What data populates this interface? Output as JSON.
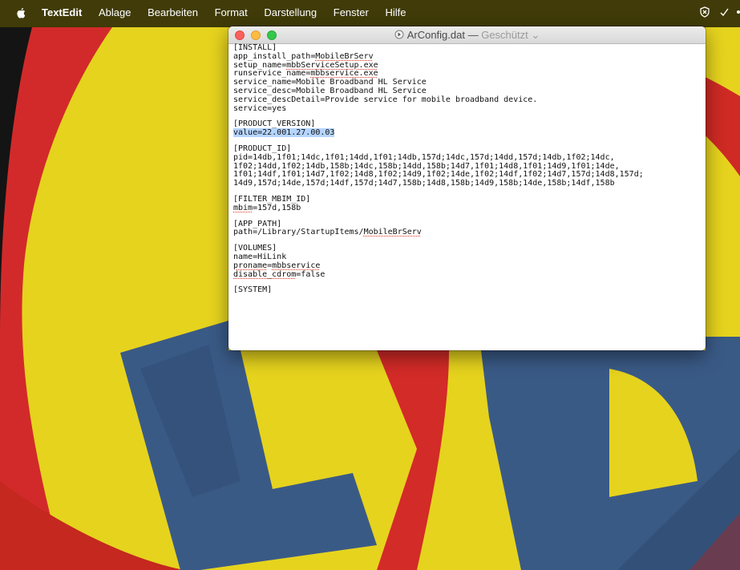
{
  "menubar": {
    "app_name": "TextEdit",
    "items": [
      "Ablage",
      "Bearbeiten",
      "Format",
      "Darstellung",
      "Fenster",
      "Hilfe"
    ]
  },
  "window": {
    "title": "ArConfig.dat",
    "title_separator": "—",
    "status": "Geschützt",
    "status_chevron": "⌄"
  },
  "document": {
    "install_header": "[INSTALL]",
    "app_install_path_key": "app_install_path=",
    "app_install_path_val": "MobileBrServ",
    "setup_name_key": "setup_name=",
    "setup_name_val": "mbbServiceSetup.exe",
    "runservice_name_key": "runservice_name=",
    "runservice_name_val": "mbbservice.exe",
    "service_name": "service_name=Mobile Broadband HL Service",
    "service_desc": "service_desc=Mobile Broadband HL Service",
    "service_descDetail": "service_descDetail=Provide service for mobile broadband device.",
    "service": "service=yes",
    "product_version_header": "[PRODUCT_VERSION]",
    "product_version_value": "value=22.001.27.00.03",
    "product_id_header": "[PRODUCT_ID]",
    "pid_line_1": "pid=14db,1f01;14dc,1f01;14dd,1f01;14db,157d;14dc,157d;14dd,157d;14db,1f02;14dc,",
    "pid_line_2": "1f02;14dd,1f02;14db,158b;14dc,158b;14dd,158b;14d7,1f01;14d8,1f01;14d9,1f01;14de,",
    "pid_line_3": "1f01;14df,1f01;14d7,1f02;14d8,1f02;14d9,1f02;14de,1f02;14df,1f02;14d7,157d;14d8,157d;",
    "pid_line_4": "14d9,157d;14de,157d;14df,157d;14d7,158b;14d8,158b;14d9,158b;14de,158b;14df,158b",
    "filter_header": "[FILTER_MBIM_ID]",
    "mbim_key": "mbim",
    "mbim_val": "=157d,158b",
    "app_path_header": "[APP_PATH]",
    "path_key": "path=/Library/StartupItems/",
    "path_val": "MobileBrServ",
    "volumes_header": "[VOLUMES]",
    "name": "name=HiLink",
    "proname_key": "proname",
    "proname_eq": "=",
    "proname_val": "mbbservice",
    "disable_key": "disable_cdrom",
    "disable_val": "=false",
    "system_header": "[SYSTEM]"
  },
  "colors": {
    "wallpaper_yellow": "#e9d61c",
    "wallpaper_blue": "#3a5a86",
    "wallpaper_red": "#d22a2a",
    "selection": "#b5d5ff"
  }
}
